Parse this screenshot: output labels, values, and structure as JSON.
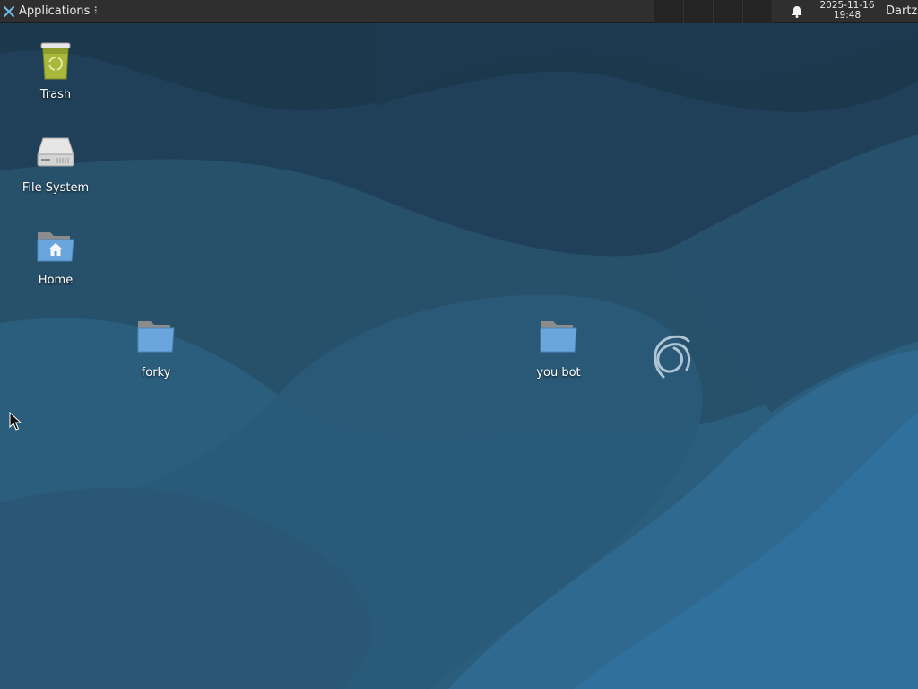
{
  "panel": {
    "applications_label": "Applications",
    "applications_handle": "⠇",
    "clock_date": "2025-11-16",
    "clock_time": "19:48",
    "user_name": "Dartz",
    "workspaces": [
      "workspace-1",
      "workspace-2",
      "workspace-3",
      "workspace-4"
    ]
  },
  "desktop": {
    "icons": [
      {
        "label": "Trash",
        "icon": "trash-icon"
      },
      {
        "label": "File System",
        "icon": "drive-icon"
      },
      {
        "label": "Home",
        "icon": "home-folder-icon"
      },
      {
        "label": "forky",
        "icon": "folder-icon"
      },
      {
        "label": "you bot",
        "icon": "folder-icon"
      }
    ],
    "wallpaper": "debian-swirl-wallpaper"
  },
  "colors": {
    "panel_bg": "#2f2f2f",
    "wallpaper_dark": "#1f3f55",
    "wallpaper_mid": "#2a5673",
    "wallpaper_light": "#2f6a90",
    "folder_blue": "#6aa6dd",
    "trash_green": "#a9b83b"
  }
}
